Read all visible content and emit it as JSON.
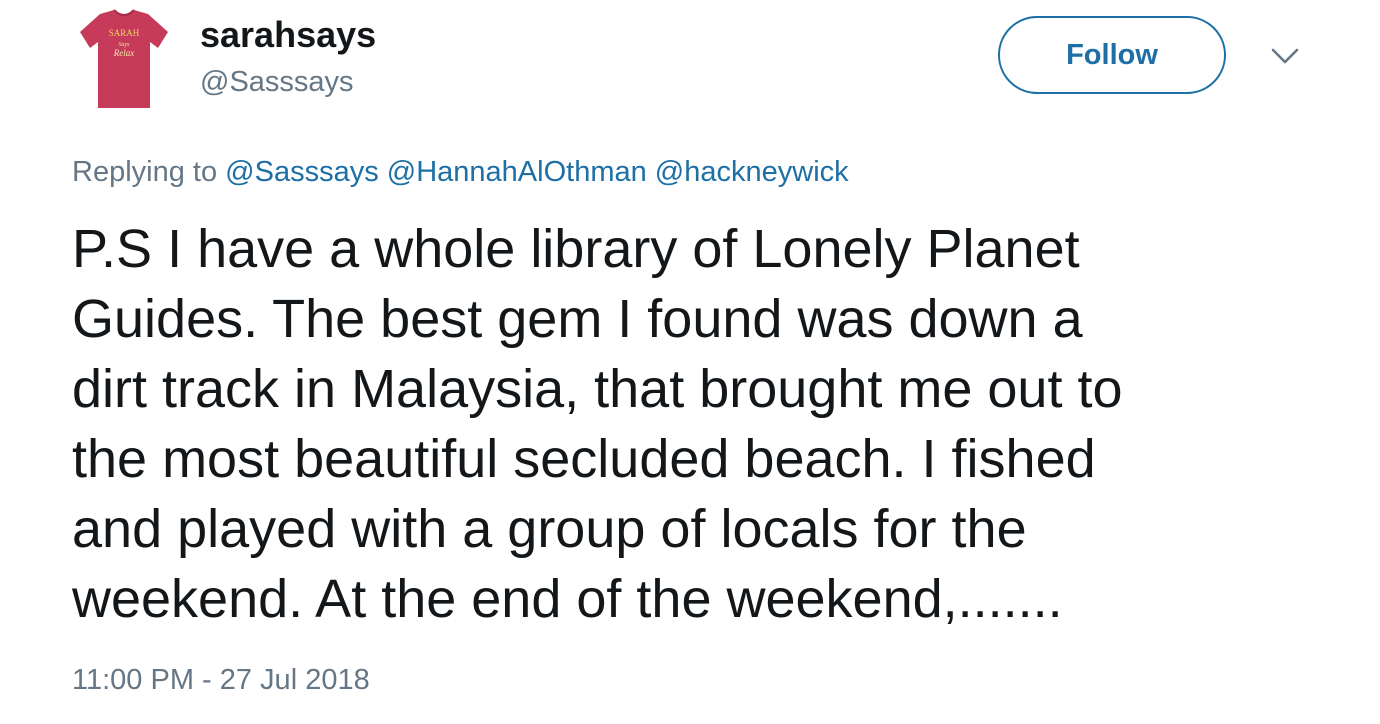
{
  "header": {
    "display_name": "sarahsays",
    "handle": "@Sasssays",
    "avatar_text": {
      "line1": "SARAH",
      "line2": "Says",
      "line3": "Relax"
    },
    "follow_label": "Follow",
    "more_icon": "chevron-down-icon"
  },
  "reply": {
    "prefix": "Replying to",
    "mentions": [
      "@Sasssays",
      "@HannahAlOthman",
      "@hackneywick"
    ]
  },
  "tweet": {
    "text": "P.S I have a whole library of Lonely Planet\nGuides. The best gem I found was down a\ndirt track in Malaysia, that brought me out to\nthe most beautiful secluded beach. I fished\nand played with a group of locals for the\nweekend. At the end of the weekend,......."
  },
  "meta": {
    "timestamp": "11:00 PM - 27 Jul 2018"
  },
  "colors": {
    "link": "#1d6fa5",
    "muted": "#657786",
    "text": "#14171a",
    "avatar_shirt": "#c63a5a"
  }
}
